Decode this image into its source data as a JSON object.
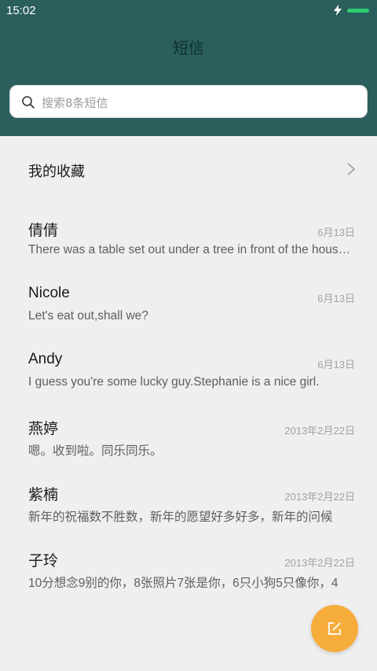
{
  "status_bar": {
    "time": "15:02",
    "battery_color": "#2ecc71"
  },
  "header": {
    "title": "短信",
    "search_placeholder": "搜索8条短信",
    "background": "#2a5f5e"
  },
  "favorites": {
    "label": "我的收藏"
  },
  "messages": [
    {
      "name": "倩倩",
      "date": "6月13日",
      "preview": "There was a table set out under a tree in front of the house, and the March Hare and the Hatter were having tea at it"
    },
    {
      "name": "Nicole",
      "date": "6月13日",
      "preview": "Let's eat out,shall we?"
    },
    {
      "name": "Andy",
      "date": "6月13日",
      "preview": "I guess you're some lucky guy.Stephanie is a nice girl."
    },
    {
      "name": "燕婷",
      "date": "2013年2月22日",
      "preview": "嗯。收到啦。同乐同乐。"
    },
    {
      "name": "紫楠",
      "date": "2013年2月22日",
      "preview": "新年的祝福数不胜数，新年的愿望好多好多，新年的问候"
    },
    {
      "name": "子玲",
      "date": "2013年2月22日",
      "preview": "10分想念9别的你，8张照片7张是你，6只小狗5只像你，4"
    }
  ],
  "fab": {
    "icon": "compose-icon",
    "color": "#f7ad3c"
  }
}
